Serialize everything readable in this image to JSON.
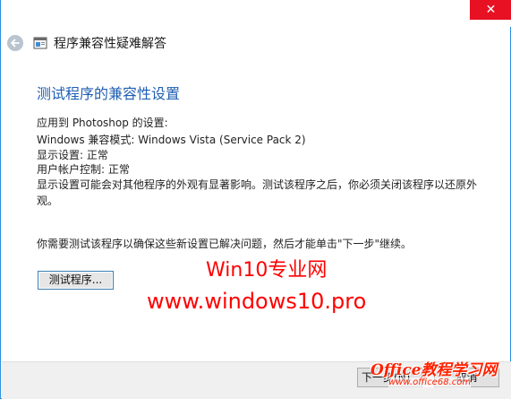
{
  "window": {
    "nav_title": "程序兼容性疑难解答",
    "close_glyph": "✕"
  },
  "content": {
    "heading": "测试程序的兼容性设置",
    "lines": [
      "应用到 Photoshop 的设置:",
      "Windows 兼容模式: Windows Vista (Service Pack 2)",
      "显示设置: 正常",
      "用户帐户控制: 正常",
      "显示设置可能会对其他程序的外观有显著影响。测试该程序之后，你必须关闭该程序以还原外",
      "观。"
    ],
    "note": "你需要测试该程序以确保这些新设置已解决问题，然后才能单击\"下一步\"继续。",
    "test_button_label": "测试程序..."
  },
  "watermark": {
    "line1": "Win10专业网",
    "line2": "www.windows10.pro"
  },
  "footer": {
    "next_label": "下一步(N)",
    "cancel_label": "取消"
  },
  "logo": {
    "main": "Office教程学习网",
    "sub": "www.office68.com"
  },
  "colors": {
    "heading": "#1f5eb2",
    "close_button": "#e81123",
    "watermark": "#ff0000",
    "window_border": "#2a91e0"
  },
  "icons": [
    "back-arrow-icon",
    "program-window-icon",
    "close-icon"
  ]
}
